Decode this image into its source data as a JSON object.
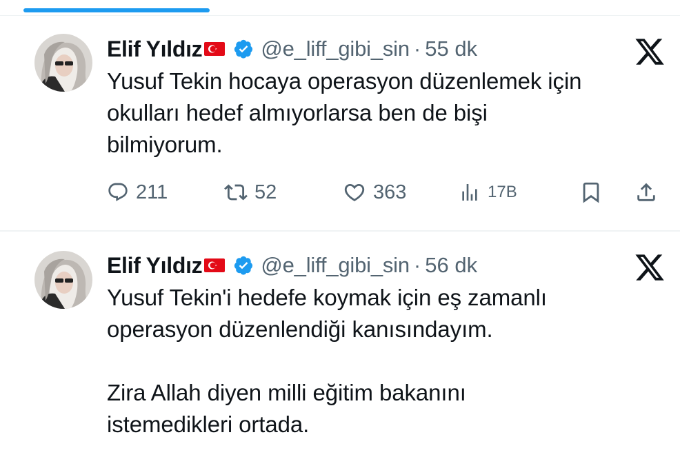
{
  "tweets": [
    {
      "author_name": "Elif Yıldız",
      "handle": "@e_liff_gibi_sin",
      "separator": "·",
      "time": "55 dk",
      "text_lines": [
        "Yusuf Tekin hocaya operasyon düzenlemek için",
        "okulları hedef almıyorlarsa ben de bişi",
        "bilmiyorum."
      ],
      "stats": {
        "replies": "211",
        "retweets": "52",
        "likes": "363",
        "views": "17B"
      }
    },
    {
      "author_name": "Elif Yıldız",
      "handle": "@e_liff_gibi_sin",
      "separator": "·",
      "time": "56 dk",
      "paragraphs": [
        [
          "Yusuf Tekin'i hedefe koymak için eş zamanlı",
          "operasyon düzenlendiği kanısındayım."
        ],
        [
          "Zira Allah diyen milli eğitim bakanını",
          "istemedikleri ortada."
        ]
      ]
    }
  ],
  "icons": {
    "flag": "turkey-flag",
    "verified": "verified-badge-icon",
    "platform": "x-logo-icon",
    "reply": "reply-icon",
    "retweet": "retweet-icon",
    "like": "heart-icon",
    "views": "views-icon",
    "bookmark": "bookmark-icon",
    "share": "share-icon"
  },
  "colors": {
    "accent": "#1d9bf0",
    "text": "#0f1419",
    "secondary": "#536471",
    "flag_red": "#e30a17"
  }
}
